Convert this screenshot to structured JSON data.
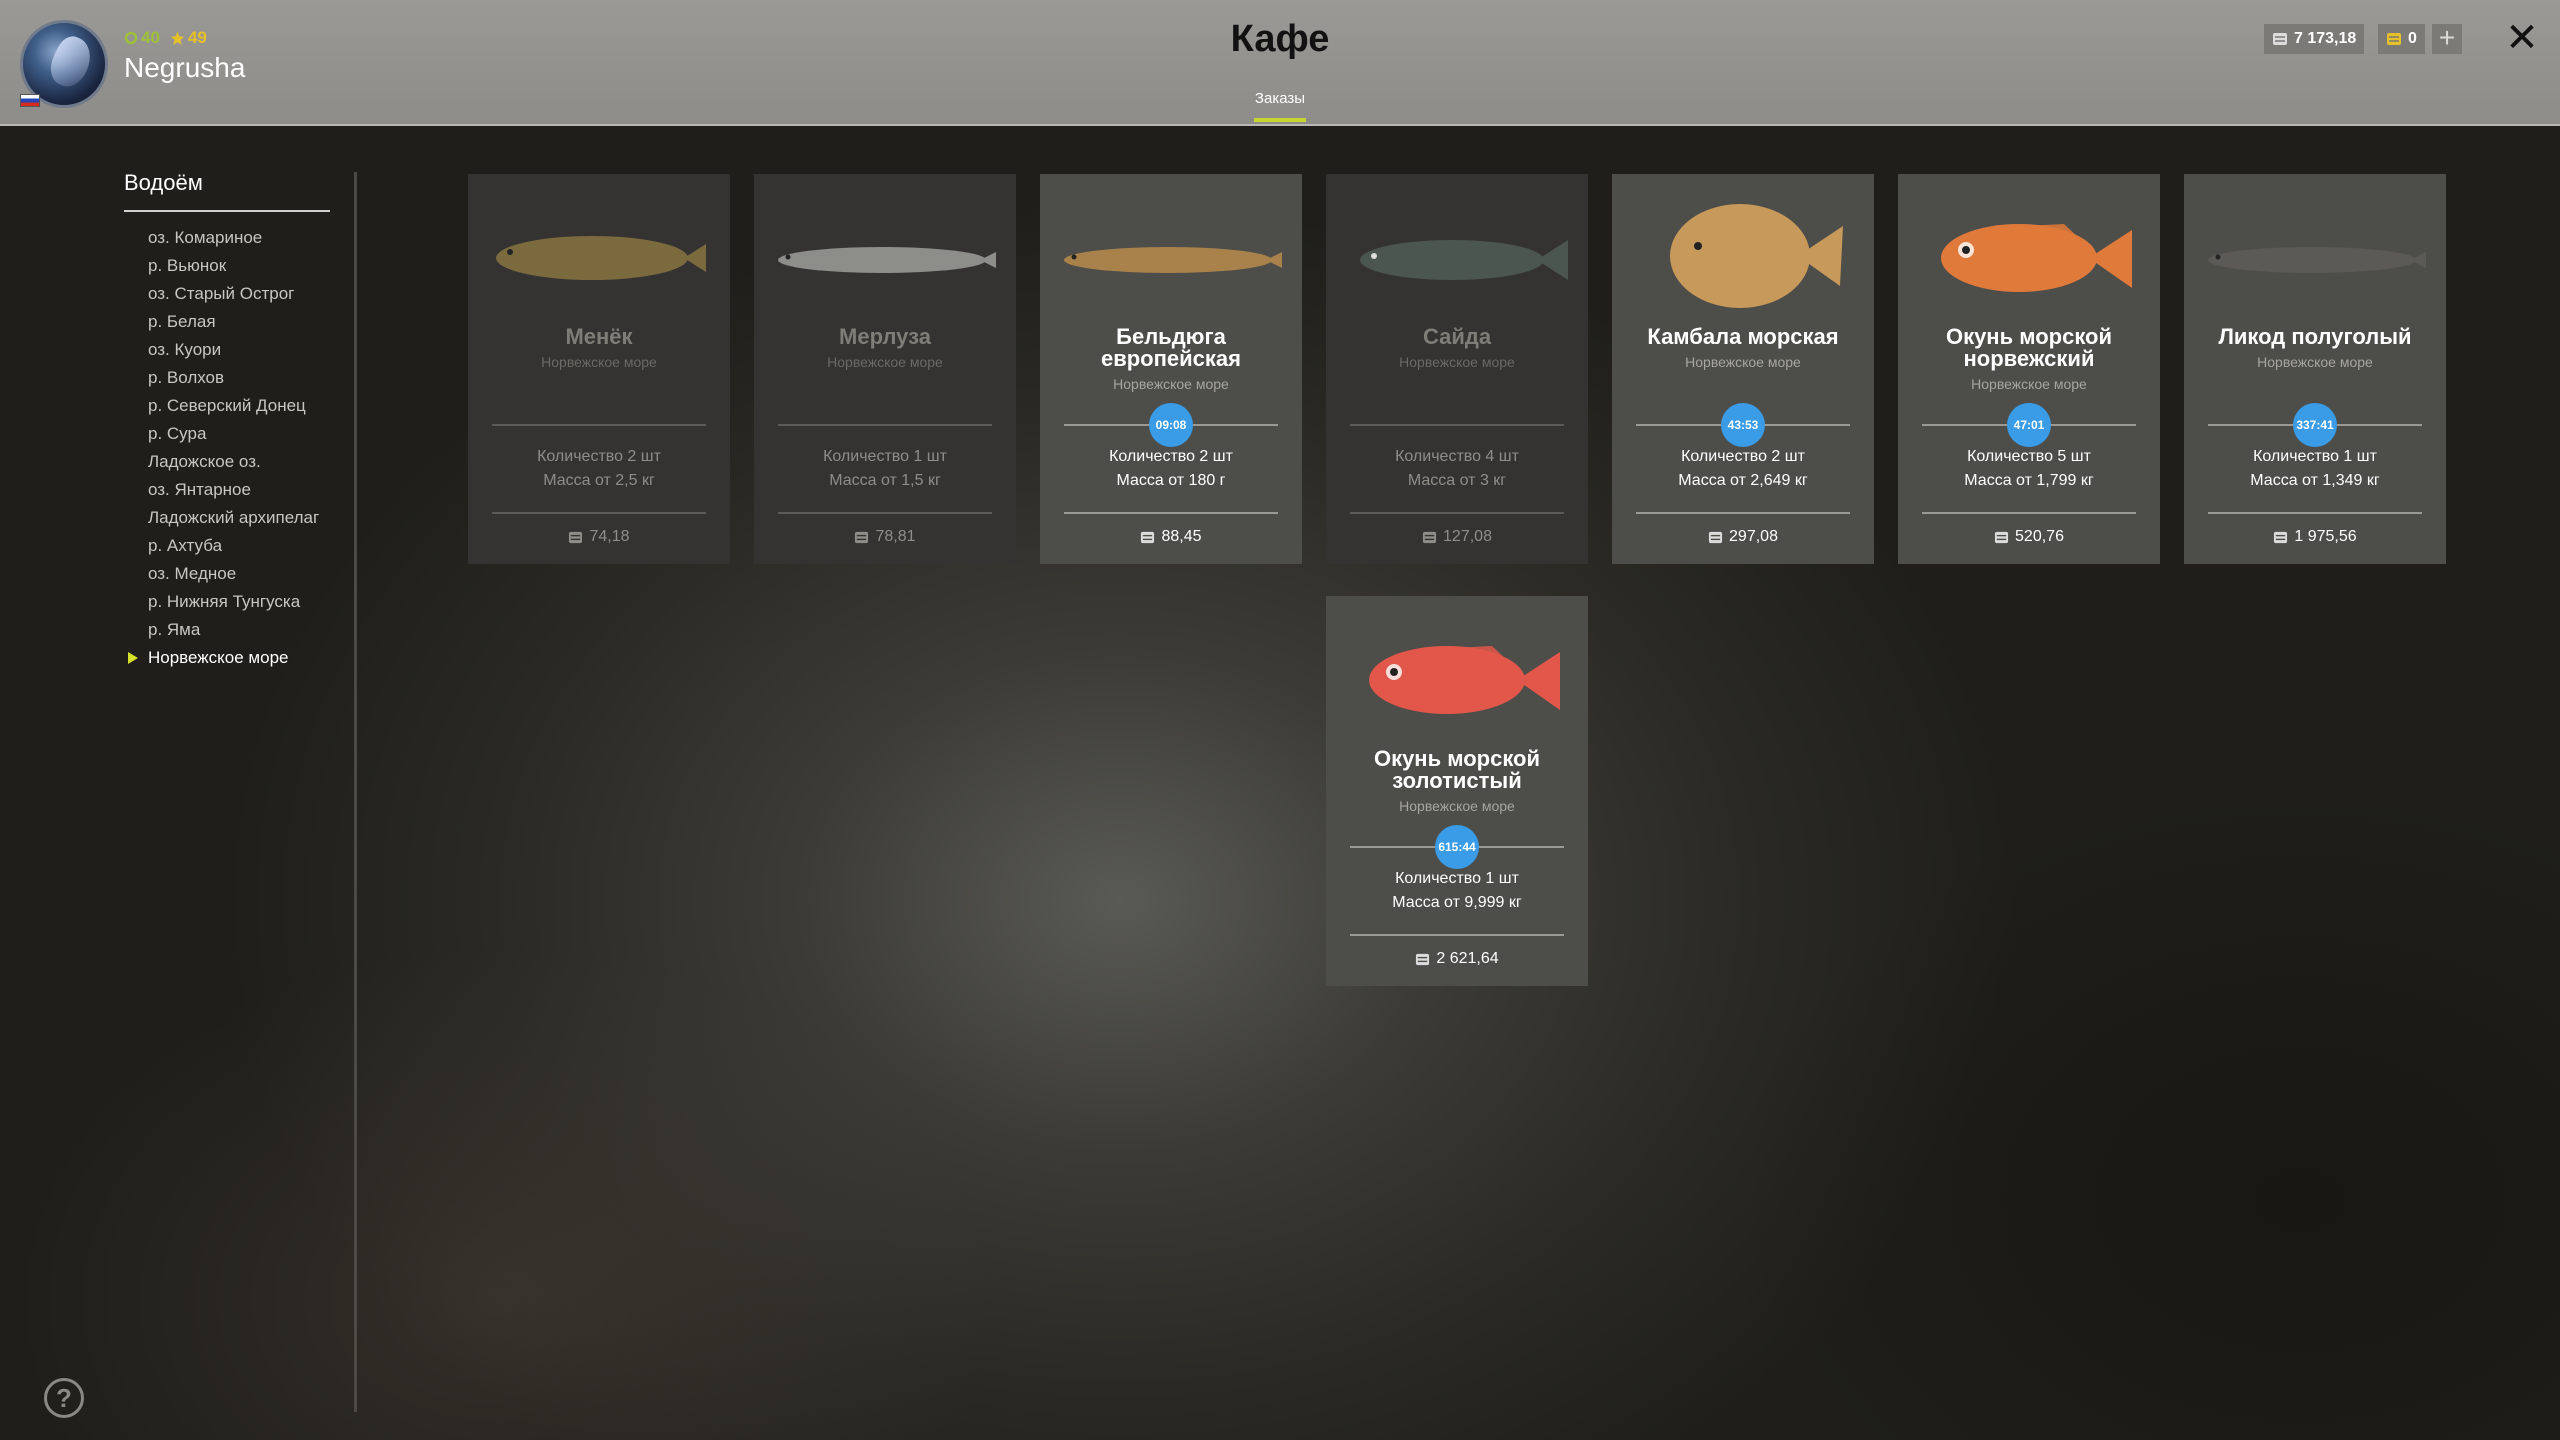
{
  "header": {
    "title": "Кафе",
    "tab_label": "Заказы",
    "player": {
      "name": "Negrusha",
      "rank": "40",
      "stars": "49"
    },
    "currency": {
      "silver": "7 173,18",
      "gold": "0",
      "plus": "+"
    },
    "close": "✕"
  },
  "sidebar": {
    "title": "Водоём",
    "items": [
      "оз. Комариное",
      "р. Вьюнок",
      "оз. Старый Острог",
      "р. Белая",
      "оз. Куори",
      "р. Волхов",
      "р. Северский Донец",
      "р. Сура",
      "Ладожское оз.",
      "оз. Янтарное",
      "Ладожский архипелаг",
      "р. Ахтуба",
      "оз. Медное",
      "р. Нижняя Тунгуска",
      "р. Яма",
      "Норвежское море"
    ],
    "active_index": 15
  },
  "orders": [
    {
      "name_line1": "Менёк",
      "name_line2": "",
      "region": "Норвежское море",
      "timer": "",
      "quantity": "Количество 2 шт",
      "mass": "Масса от 2,5 кг",
      "price": "74,18",
      "available": false,
      "fish_icon": "tusk-fish",
      "fish_color": "#7a6a3e"
    },
    {
      "name_line1": "Мерлуза",
      "name_line2": "",
      "region": "Норвежское море",
      "timer": "",
      "quantity": "Количество 1 шт",
      "mass": "Масса от 1,5 кг",
      "price": "78,81",
      "available": false,
      "fish_icon": "hake-fish",
      "fish_color": "#8d8d8a"
    },
    {
      "name_line1": "Бельдюга",
      "name_line2": "европейская",
      "region": "Норвежское море",
      "timer": "09:08",
      "quantity": "Количество 2 шт",
      "mass": "Масса от 180 г",
      "price": "88,45",
      "available": true,
      "fish_icon": "eelpout-fish",
      "fish_color": "#a8824a"
    },
    {
      "name_line1": "Сайда",
      "name_line2": "",
      "region": "Норвежское море",
      "timer": "",
      "quantity": "Количество 4 шт",
      "mass": "Масса от 3 кг",
      "price": "127,08",
      "available": false,
      "fish_icon": "saithe-fish",
      "fish_color": "#4c5650"
    },
    {
      "name_line1": "Камбала морская",
      "name_line2": "",
      "region": "Норвежское море",
      "timer": "43:53",
      "quantity": "Количество 2 шт",
      "mass": "Масса от 2,649 кг",
      "price": "297,08",
      "available": true,
      "fish_icon": "plaice-fish",
      "fish_color": "#c79a5c"
    },
    {
      "name_line1": "Окунь морской",
      "name_line2": "норвежский",
      "region": "Норвежское море",
      "timer": "47:01",
      "quantity": "Количество 5 шт",
      "mass": "Масса от 1,799 кг",
      "price": "520,76",
      "available": true,
      "fish_icon": "redfish-fish",
      "fish_color": "#e07a3a"
    },
    {
      "name_line1": "Ликод полуголый",
      "name_line2": "",
      "region": "Норвежское море",
      "timer": "337:41",
      "quantity": "Количество 1 шт",
      "mass": "Масса от 1,349 кг",
      "price": "1 975,56",
      "available": true,
      "fish_icon": "eelpout-dark-fish",
      "fish_color": "#5b5a56"
    },
    {
      "name_line1": "Окунь морской",
      "name_line2": "золотистый",
      "region": "Норвежское море",
      "timer": "615:44",
      "quantity": "Количество 1 шт",
      "mass": "Масса от 9,999 кг",
      "price": "2 621,64",
      "available": true,
      "fish_icon": "golden-redfish-fish",
      "fish_color": "#e2574a"
    }
  ],
  "help": "?"
}
